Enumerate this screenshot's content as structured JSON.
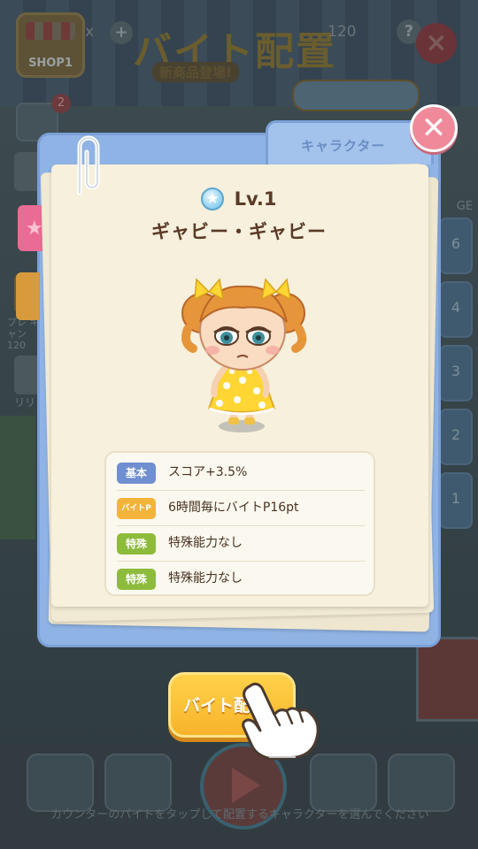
{
  "background": {
    "shop_label": "SHOP1",
    "title": "バイト配置",
    "subtitle": "新商品登場!",
    "counter": "120",
    "top_x": "x",
    "plus": "+",
    "help": "?",
    "mail_badge": "2",
    "side_label_1": "プレ キャン 120",
    "side_label_2": "リリ",
    "right_label": "GE",
    "right_nums": [
      "6",
      "4",
      "3",
      "2",
      "1"
    ],
    "hint": "カウンターのバイトをタップして配置するキャラクターを選んでください"
  },
  "popup": {
    "folder_tab": "キャラクター",
    "close": "✕",
    "level": "Lv.1",
    "character_name": "ギャビー・ギャビー",
    "stats": [
      {
        "badge": "基本",
        "badge_color": "#6f8fd0",
        "text": "スコア+3.5%"
      },
      {
        "badge": "バイトP",
        "badge_color": "#f3b43a",
        "text": "6時間毎にバイトP16pt"
      },
      {
        "badge": "特殊",
        "badge_color": "#8dbb3c",
        "text": "特殊能力なし"
      },
      {
        "badge": "特殊",
        "badge_color": "#8dbb3c",
        "text": "特殊能力なし"
      }
    ]
  },
  "cta": {
    "label": "バイト配"
  },
  "colors": {
    "folder": "#8fb3e4",
    "paper": "#f6f0dc",
    "close_button": "#f08a9a",
    "cta": "#f7b32a",
    "text_brown": "#5a3a26"
  }
}
